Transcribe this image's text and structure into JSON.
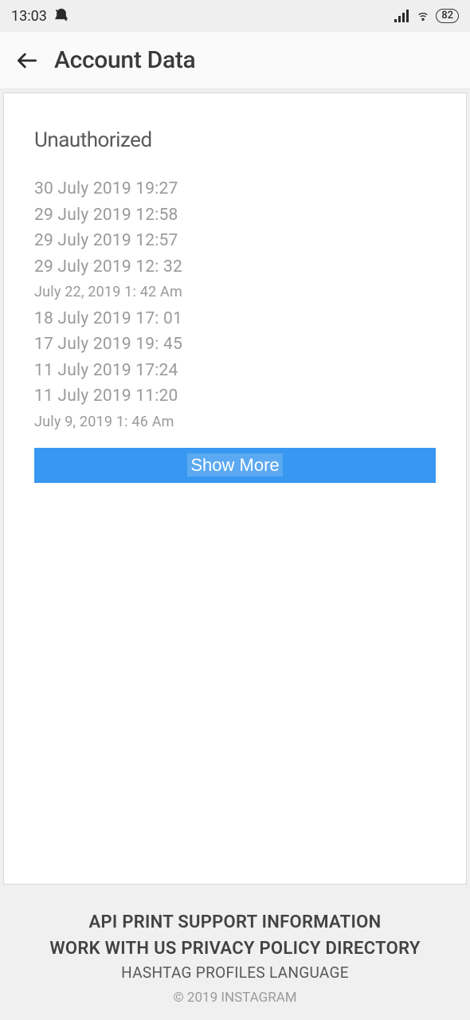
{
  "status": {
    "time": "13:03",
    "battery": "82"
  },
  "header": {
    "title": "Account Data"
  },
  "section": {
    "title": "Unauthorized"
  },
  "activity": [
    {
      "text": "30 July 2019 19:27",
      "small": false
    },
    {
      "text": "29 July 2019 12:58",
      "small": false
    },
    {
      "text": "29 July 2019 12:57",
      "small": false
    },
    {
      "text": "29 July 2019 12: 32",
      "small": false
    },
    {
      "text": "July 22, 2019 1: 42 Am",
      "small": true
    },
    {
      "text": "18 July 2019 17: 01",
      "small": false
    },
    {
      "text": "17 July 2019 19: 45",
      "small": false
    },
    {
      "text": "11 July 2019 17:24",
      "small": false
    },
    {
      "text": "11 July 2019 11:20",
      "small": false
    },
    {
      "text": "July 9, 2019 1: 46 Am",
      "small": true
    }
  ],
  "show_more_label": "Show More",
  "footer": {
    "line1": "API PRINT SUPPORT INFORMATION",
    "line2": "WORK WITH US PRIVACY POLICY DIRECTORY",
    "line3": "HASHTAG PROFILES LANGUAGE",
    "copyright": "© 2019 INSTAGRAM"
  }
}
